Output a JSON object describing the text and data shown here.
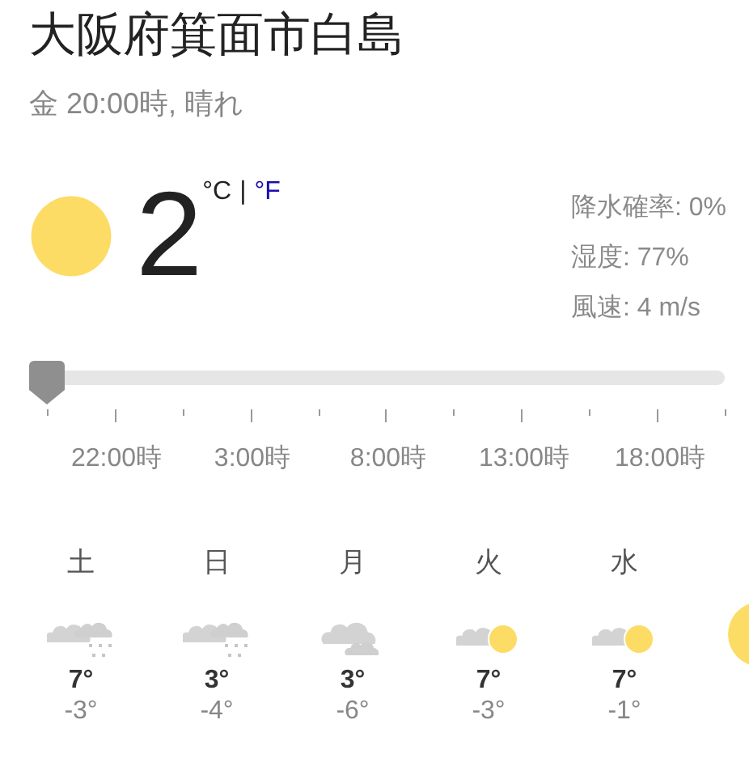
{
  "location": "大阪府箕面市白島",
  "subtitle": "金 20:00時, 晴れ",
  "current": {
    "kind": "sunny",
    "temperature": "2",
    "unit_c": "°C",
    "separator": "|",
    "unit_f": "°F"
  },
  "details": [
    "降水確率: 0%",
    "湿度: 77%",
    "風速: 4 m/s"
  ],
  "timeline": {
    "level": 0,
    "labels": [
      "22:00時",
      "3:00時",
      "8:00時",
      "13:00時",
      "18:00時"
    ]
  },
  "days": [
    {
      "day": "土",
      "kind": "snow",
      "high": "7°",
      "low": "-3°"
    },
    {
      "day": "日",
      "kind": "snow",
      "high": "3°",
      "low": "-4°"
    },
    {
      "day": "月",
      "kind": "cloudy",
      "high": "3°",
      "low": "-6°"
    },
    {
      "day": "火",
      "kind": "partly-sunny",
      "high": "7°",
      "low": "-3°"
    },
    {
      "day": "水",
      "kind": "partly-sunny",
      "high": "7°",
      "low": "-1°"
    },
    {
      "kind": "sunny"
    }
  ]
}
